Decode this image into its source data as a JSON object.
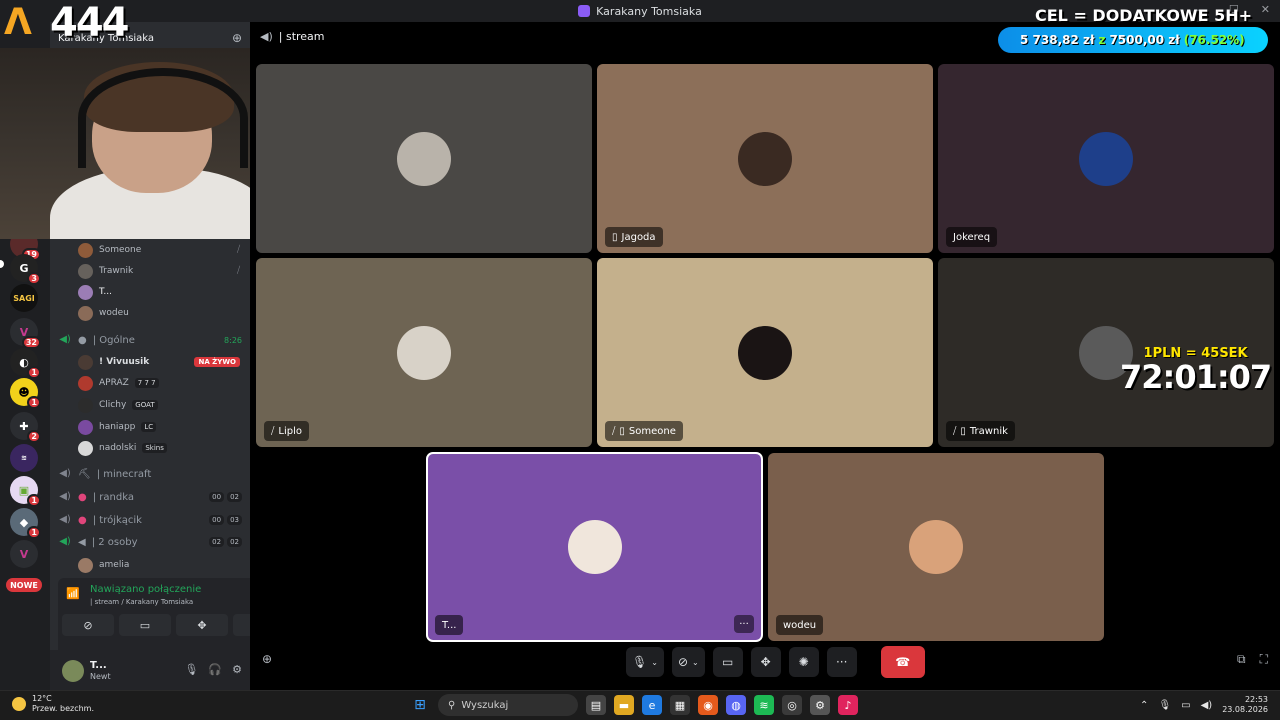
{
  "window": {
    "title": "Karakany Tomsiaka"
  },
  "overlay": {
    "logo_number": "444",
    "goal_title": "CEL = DODATKOWE 5H+",
    "goal_current": "5 738,82 zł",
    "goal_separator": "z",
    "goal_target": "7500,00 zł",
    "goal_percent": "(76.52%)",
    "goal_progress": 0.7652,
    "timer_rate": "1PLN = 45SEK",
    "timer_value": "72:01:07"
  },
  "sidebar": {
    "server_name": "Karakany Tomsiaka",
    "voice_users_top": [
      {
        "name": "Someone",
        "color": "#8f5b3a"
      },
      {
        "name": "Trawnik",
        "color": "#66615c"
      },
      {
        "name": "T...",
        "color": "#9b7db5"
      },
      {
        "name": "wodeu",
        "color": "#8a6b58"
      }
    ],
    "channel_ogolne": {
      "name": "| Ogólne",
      "time": "8:26"
    },
    "ogolne_users": [
      {
        "name": "! Vivuusik",
        "live": "NA ŻYWO",
        "color": "#4a3b34"
      },
      {
        "name": "APRAZ",
        "tag": "7 7 7",
        "color": "#b03a2e"
      },
      {
        "name": "Clichy",
        "tag": "GOAT",
        "color": "#2c2c2c"
      },
      {
        "name": "haniapp",
        "tag": "LC",
        "color": "#7a4aa0"
      },
      {
        "name": "nadolski",
        "tag": "Skins",
        "color": "#d8d8d8"
      }
    ],
    "channels": [
      {
        "name": "| minecraft"
      },
      {
        "name": "| randka",
        "a": "00",
        "b": "02"
      },
      {
        "name": "| trójkącik",
        "a": "00",
        "b": "03"
      },
      {
        "name": "| 2 osoby",
        "a": "02",
        "b": "02"
      }
    ],
    "amelia": "amelia",
    "voice_panel": {
      "status": "Nawiązano połączenie",
      "location": "| stream / Karakany Tomsiaka"
    },
    "user": {
      "name": "T...",
      "status": "Newt"
    },
    "new_badge": "NOWE"
  },
  "rail": {
    "badges": [
      "19",
      "3",
      "32",
      "1",
      "1",
      "2",
      "1",
      "1"
    ]
  },
  "main": {
    "channel": "| stream",
    "tiles": [
      {
        "label": "",
        "bg": "#4a4845",
        "avatar": "#b9b3aa"
      },
      {
        "label": "Jagoda",
        "bg": "#8c6f59",
        "avatar": "#3a2a22"
      },
      {
        "label": "Jokereq",
        "bg": "#35262f",
        "avatar": "#1e3f8a"
      },
      {
        "label": "Liplo",
        "bg": "#6e6453",
        "avatar": "#d8d2c8"
      },
      {
        "label": "Someone",
        "bg": "#c4b08c",
        "avatar": "#1a1414"
      },
      {
        "label": "Trawnik",
        "bg": "#2e2b27",
        "avatar": "#5a5a5a"
      },
      {
        "label": "T...",
        "bg": "#7a4fa8",
        "avatar": "#f0e6dc"
      },
      {
        "label": "wodeu",
        "bg": "#7a5f4c",
        "avatar": "#d9a27a"
      }
    ]
  },
  "taskbar": {
    "temp": "12°C",
    "weather": "Przew. bezchm.",
    "search": "Wyszukaj",
    "time": "22:53",
    "date": "23.08.2026"
  }
}
